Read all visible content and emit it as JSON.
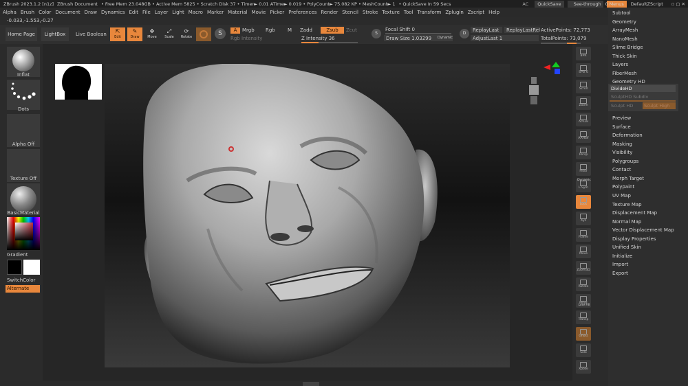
{
  "titlebar": {
    "app": "ZBrush 2023.1.2 [n1z]",
    "document": "ZBrush Document",
    "stats": "• Free Mem 23.048GB • Active Mem 5825 • Scratch Disk 37 • Timer► 0.01 ATime► 0.019 • PolyCount► 75.082 KP • MeshCount► 1",
    "quicksave_timer": "• QuickSave In 59 Secs",
    "ac": "AC",
    "quicksave": "QuickSave",
    "seethrough": "See-through",
    "seethrough_value": "0",
    "menus": "Menus",
    "script": "DefaultZScript"
  },
  "menubar": [
    "Alpha",
    "Brush",
    "Color",
    "Document",
    "Draw",
    "Dynamics",
    "Edit",
    "File",
    "Layer",
    "Light",
    "Macro",
    "Marker",
    "Material",
    "Movie",
    "Picker",
    "Preferences",
    "Render",
    "Stencil",
    "Stroke",
    "Texture",
    "Tool",
    "Transform",
    "Zplugin",
    "Zscript",
    "Help"
  ],
  "coords": "-0.033,-1.553,-0.27",
  "shelf": {
    "home_page": "Home Page",
    "lightbox": "LightBox",
    "live_boolean": "Live Boolean",
    "edit": "Edit",
    "draw": "Draw",
    "move": "Move",
    "scale": "Scale",
    "rotate": "Rotate",
    "a": "A",
    "mrgb": "Mrgb",
    "rgb": "Rgb",
    "m": "M",
    "zadd": "Zadd",
    "zsub": "Zsub",
    "zcut": "Zcut",
    "rgb_intensity": "Rgb Intensity",
    "z_intensity": "Z Intensity 36",
    "focal_shift": "Focal Shift 0",
    "draw_size": "Draw Size 1.03299",
    "dynamic": "Dynamic",
    "replay_last": "ReplayLast",
    "replay_last_rel": "ReplayLastRel",
    "adjust_last": "AdjustLast 1",
    "active_points": "ActivePoints: 72,773",
    "total_points": "TotalPoints: 73,079",
    "s_label": "S",
    "d_label": "D"
  },
  "leftshelf": {
    "brush": "Inflat",
    "stroke": "Dots",
    "alpha": "Alpha Off",
    "texture": "Texture Off",
    "material": "BasicMaterial",
    "gradient": "Gradient",
    "switchcolor": "SwitchColor",
    "alternate": "Alternate"
  },
  "rightshelf": [
    "BPR",
    "SPix 6",
    "Scroll",
    "Zoom",
    "Actual",
    "AAHalf",
    "Persp",
    "Floor",
    "L.Sym",
    "Lock",
    "Xyz",
    "Frame",
    "Move",
    "Zoom3D",
    "Rotate",
    "PolyF",
    "Transp",
    "Ghost",
    "Solo",
    "Xpose"
  ],
  "rightshelf_labels": {
    "dynamic": "Dynamic",
    "line_fill": "Line Fill"
  },
  "palette": {
    "items_top": [
      "Subtool",
      "Geometry",
      "ArrayMesh",
      "NanoMesh",
      "Slime Bridge",
      "Thick Skin",
      "Layers",
      "FiberMesh",
      "Geometry HD"
    ],
    "hd_sub": [
      "DivideHD",
      "SculptHD Subdiv",
      "Sculpt HD",
      "Sculpt High"
    ],
    "items_bottom": [
      "Preview",
      "Surface",
      "Deformation",
      "Masking",
      "Visibility",
      "Polygroups",
      "Contact",
      "Morph Target",
      "Polypaint",
      "UV Map",
      "Texture Map",
      "Displacement Map",
      "Normal Map",
      "Vector Displacement Map",
      "Display Properties",
      "Unified Skin",
      "Initialize",
      "Import",
      "Export"
    ]
  },
  "colors": {
    "accent": "#e8873c",
    "background": "#2b2b2b"
  }
}
